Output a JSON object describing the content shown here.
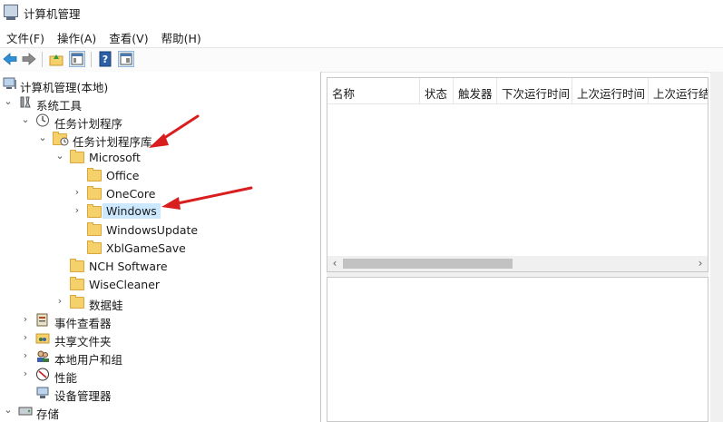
{
  "window": {
    "title": "计算机管理"
  },
  "menu": [
    "文件(F)",
    "操作(A)",
    "查看(V)",
    "帮助(H)"
  ],
  "toolbar": {
    "buttons": [
      "back-arrow-icon",
      "forward-arrow-icon",
      "up-folder-icon",
      "show-hide-tree-icon",
      "help-icon",
      "properties-icon"
    ]
  },
  "tree": {
    "root": "计算机管理(本地)",
    "system_tools": "系统工具",
    "task_scheduler": "任务计划程序",
    "task_library": "任务计划程序库",
    "microsoft": "Microsoft",
    "office": "Office",
    "onecore": "OneCore",
    "windows": "Windows",
    "windows_update": "WindowsUpdate",
    "xbl_game_save": "XblGameSave",
    "nch_software": "NCH Software",
    "wisecleaner": "WiseCleaner",
    "shujuwa": "数据蛙",
    "event_viewer": "事件查看器",
    "shared_folders": "共享文件夹",
    "local_users": "本地用户和组",
    "performance": "性能",
    "device_manager": "设备管理器",
    "storage": "存储"
  },
  "list": {
    "columns": [
      "名称",
      "状态",
      "触发器",
      "下次运行时间",
      "上次运行时间",
      "上次运行结"
    ]
  },
  "colors": {
    "annotation_arrow": "#d81e1e",
    "selection": "#cce8ff",
    "folder": "#f6d06a"
  }
}
